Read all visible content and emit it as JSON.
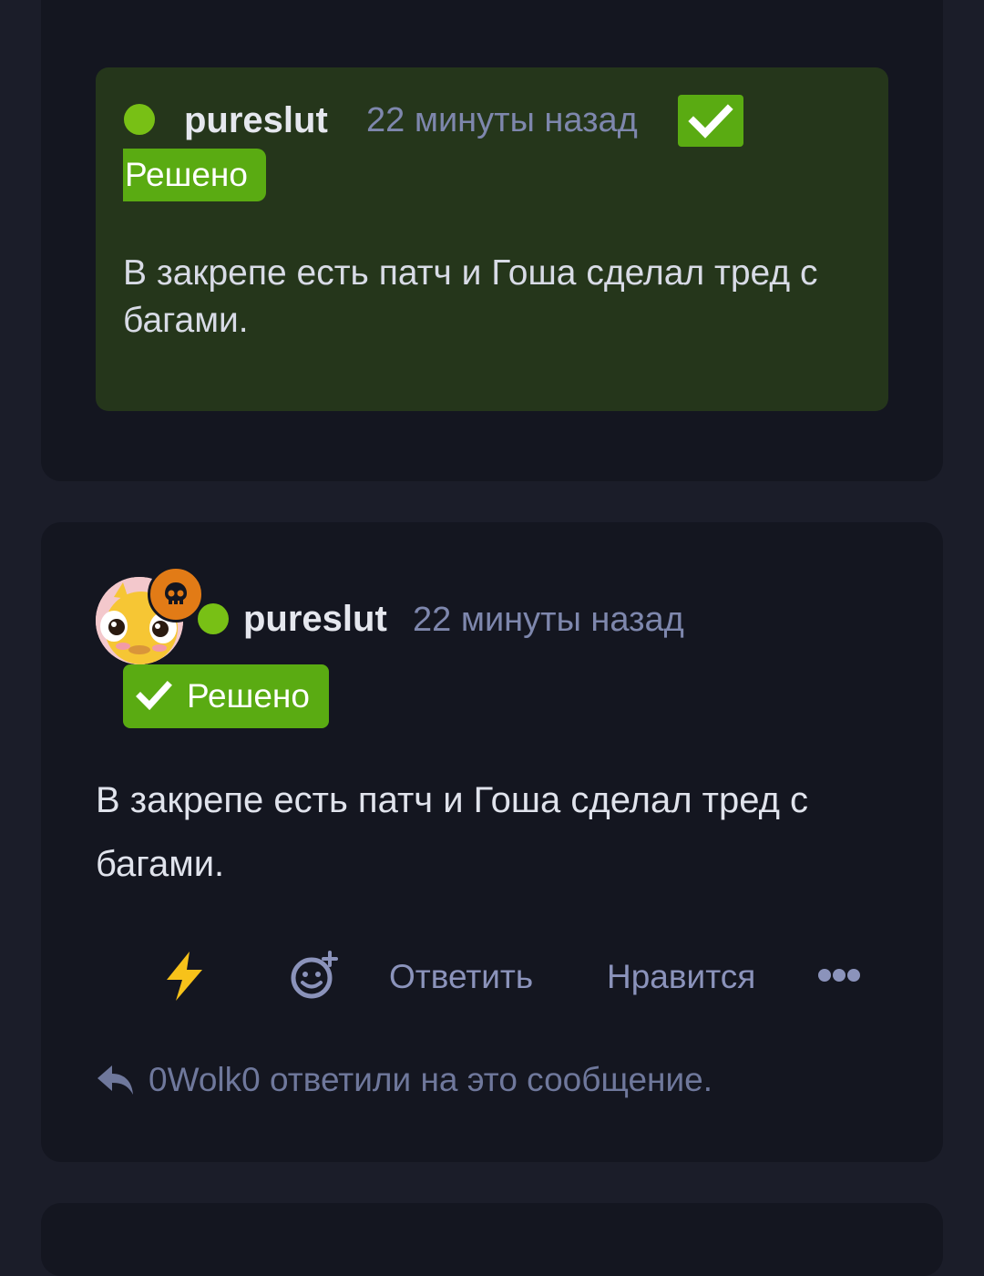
{
  "quote": {
    "username": "pureslut",
    "time": "22 минуты назад",
    "solved_label": "Решено",
    "text": "В закрепе есть патч и Гоша сделал тред с багами."
  },
  "post": {
    "username": "pureslut",
    "time": "22 минуты назад",
    "solved_label": "Решено",
    "text": "В закрепе есть патч и Гоша сделал тред с багами.",
    "actions": {
      "reply_label": "Ответить",
      "like_label": "Нравится"
    },
    "replies_text": "0Wolk0 ответили на это сообщение."
  },
  "colors": {
    "page_bg": "#1b1d29",
    "card_bg": "#141620",
    "quote_bg": "#25361b",
    "solved_green": "#5aab12",
    "online_dot": "#78c015",
    "badge_orange": "#e27b16"
  }
}
